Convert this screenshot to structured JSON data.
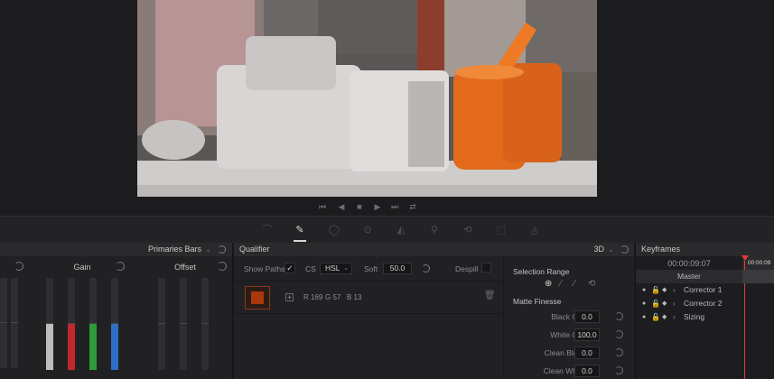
{
  "transport": {
    "icons": [
      "skip-to-start-icon",
      "play-reverse-icon",
      "stop-icon",
      "play-icon",
      "skip-to-end-icon",
      "loop-icon"
    ],
    "glyphs": [
      "⏮",
      "◀",
      "■",
      "▶",
      "⏭",
      "⇄"
    ]
  },
  "palette_tools": [
    {
      "name": "curves-tool-icon",
      "glyph": "⌒",
      "active": false
    },
    {
      "name": "qualifier-eyedropper-icon",
      "glyph": "✎",
      "active": true
    },
    {
      "name": "window-tool-icon",
      "glyph": "◯",
      "active": false
    },
    {
      "name": "tracker-tool-icon",
      "glyph": "⊙",
      "active": false
    },
    {
      "name": "blur-tool-icon",
      "glyph": "◭",
      "active": false
    },
    {
      "name": "key-tool-icon",
      "glyph": "⚲",
      "active": false
    },
    {
      "name": "sizing-tool-icon",
      "glyph": "⟲",
      "active": false
    },
    {
      "name": "3d-tool-icon",
      "glyph": "⬚",
      "active": false
    },
    {
      "name": "stereo-tool-icon",
      "glyph": "◬",
      "active": false
    }
  ],
  "primaries": {
    "mode_label": "Primaries Bars",
    "gain_label": "Gain",
    "offset_label": "Offset",
    "bar_levels": {
      "lift_y": 0.5,
      "lift_r": 0.5,
      "gain_y": 0.5,
      "gain_r": 0.5,
      "gain_g": 0.5,
      "gain_b": 0.5,
      "offset_y": 0.5,
      "offset_r": 0.5,
      "offset_g": 0.5
    },
    "colors": {
      "luma": "#bdbdbd",
      "red": "#c1272d",
      "green": "#2e9a3a",
      "blue": "#2c6fc4"
    }
  },
  "qualifier": {
    "title": "Qualifier",
    "mode": "3D",
    "show_paths_label": "Show Paths",
    "show_paths_checked": true,
    "cs_label": "CS",
    "cs_value": "HSL",
    "soft_label": "Soft",
    "soft_value": "50.0",
    "despill_label": "Despill",
    "swatch_color": "#a9390d",
    "swatch_readout": {
      "r": "R 169",
      "g": "G 57",
      "b": "B 13"
    },
    "selection_range_label": "Selection Range",
    "matte_finesse_label": "Matte Finesse",
    "matte_fields": [
      {
        "label": "Black Clip",
        "value": "0.0"
      },
      {
        "label": "White Clip",
        "value": "100.0"
      },
      {
        "label": "Clean Black",
        "value": "0.0"
      },
      {
        "label": "Clean White",
        "value": "0.0"
      }
    ]
  },
  "keyframes": {
    "title": "Keyframes",
    "timecode": "00:00:09:07",
    "ruler_timecode": "00:00:09",
    "playhead_color": "#e03c3c",
    "rows": [
      "Master",
      "Corrector 1",
      "Corrector 2",
      "Sizing"
    ]
  }
}
